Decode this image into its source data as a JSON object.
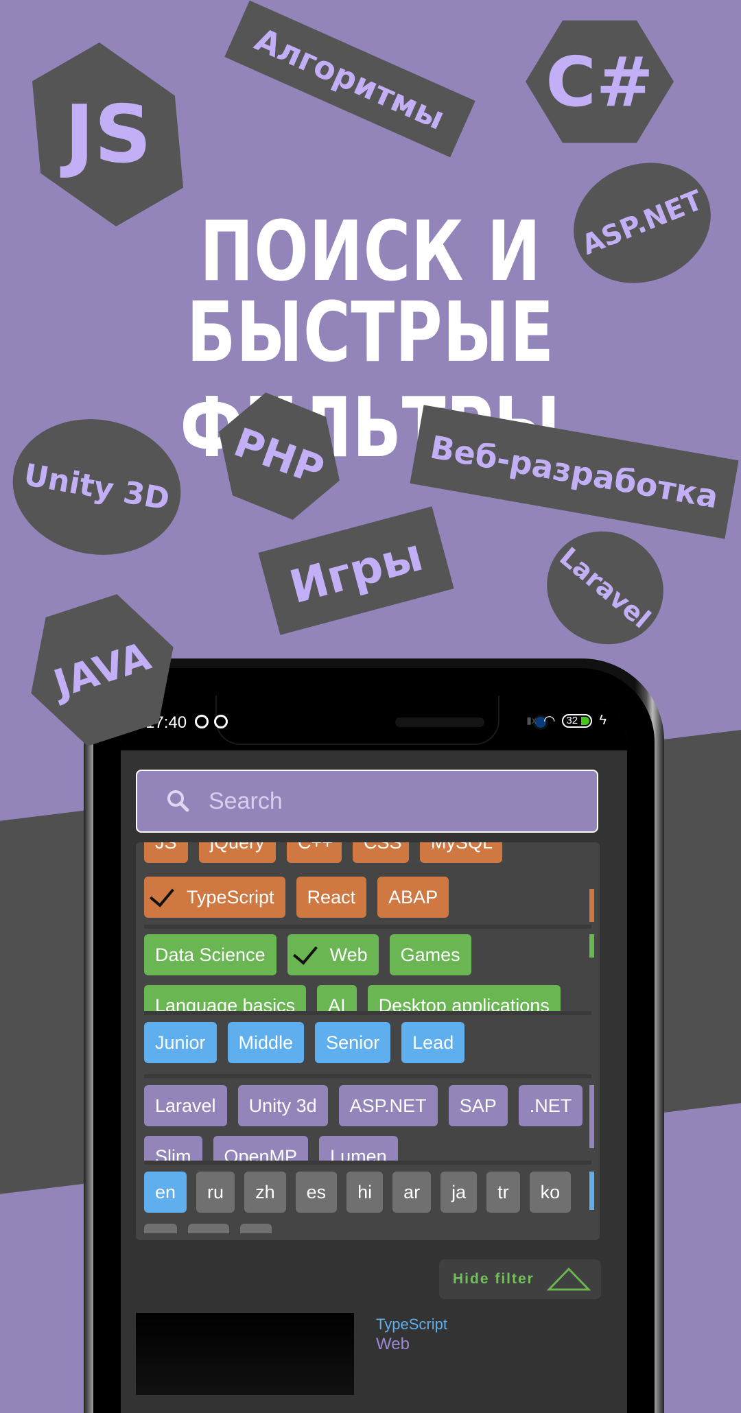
{
  "headline": {
    "line1": "ПОИСК И",
    "line2": "БЫСТРЫЕ ФИЛЬТРЫ"
  },
  "badges": [
    {
      "label": "JS",
      "shape": "hexagon"
    },
    {
      "label": "Алгоритмы",
      "shape": "rectangle"
    },
    {
      "label": "C#",
      "shape": "hexagon"
    },
    {
      "label": "ASP.NET",
      "shape": "oval"
    },
    {
      "label": "Unity 3D",
      "shape": "oval"
    },
    {
      "label": "PHP",
      "shape": "hexagon"
    },
    {
      "label": "Веб-разработка",
      "shape": "rectangle"
    },
    {
      "label": "Игры",
      "shape": "rectangle"
    },
    {
      "label": "Laravel",
      "shape": "oval"
    },
    {
      "label": "JAVA",
      "shape": "hexagon"
    }
  ],
  "colors": {
    "background": "#9385b9",
    "badge_bg": "#555555",
    "badge_text": "#c3aff5",
    "orange": "#d07842",
    "green": "#6ab653",
    "blue": "#5faeed",
    "purple": "#9385b9",
    "grey": "#707070",
    "hide_filter_text": "#72c05a"
  },
  "status_bar": {
    "time": "17:40",
    "battery": "32",
    "icons": [
      "app-icon",
      "app-icon",
      "signal-icon",
      "wifi-icon",
      "battery-icon",
      "charging-icon"
    ]
  },
  "search": {
    "placeholder": "Search",
    "icon": "search-icon"
  },
  "filters": {
    "languages_partial": [
      "JS",
      "jQuery",
      "C++",
      "CSS",
      "MySQL"
    ],
    "languages": [
      {
        "label": "TypeScript",
        "selected": true
      },
      {
        "label": "React",
        "selected": false
      },
      {
        "label": "ABAP",
        "selected": false
      }
    ],
    "categories": [
      {
        "label": "Data Science",
        "selected": false
      },
      {
        "label": "Web",
        "selected": true
      },
      {
        "label": "Games",
        "selected": false
      }
    ],
    "categories_partial": [
      "Language basics",
      "AI",
      "Desktop applications"
    ],
    "levels": [
      {
        "label": "Junior"
      },
      {
        "label": "Middle"
      },
      {
        "label": "Senior"
      },
      {
        "label": "Lead"
      }
    ],
    "frameworks": [
      {
        "label": "Laravel"
      },
      {
        "label": "Unity 3d"
      },
      {
        "label": "ASP.NET"
      },
      {
        "label": "SAP"
      },
      {
        "label": ".NET"
      }
    ],
    "frameworks_partial": [
      "Slim",
      "OpenMP",
      "Lumen"
    ],
    "locales": [
      {
        "label": "en",
        "selected": true
      },
      {
        "label": "ru",
        "selected": false
      },
      {
        "label": "zh",
        "selected": false
      },
      {
        "label": "es",
        "selected": false
      },
      {
        "label": "hi",
        "selected": false
      },
      {
        "label": "ar",
        "selected": false
      },
      {
        "label": "ja",
        "selected": false
      },
      {
        "label": "tr",
        "selected": false
      },
      {
        "label": "ko",
        "selected": false
      }
    ]
  },
  "hide_filter": {
    "label": "Hide filter",
    "icon": "triangle-up-icon"
  },
  "result_preview": {
    "tag1": "TypeScript",
    "tag2": "Web"
  }
}
